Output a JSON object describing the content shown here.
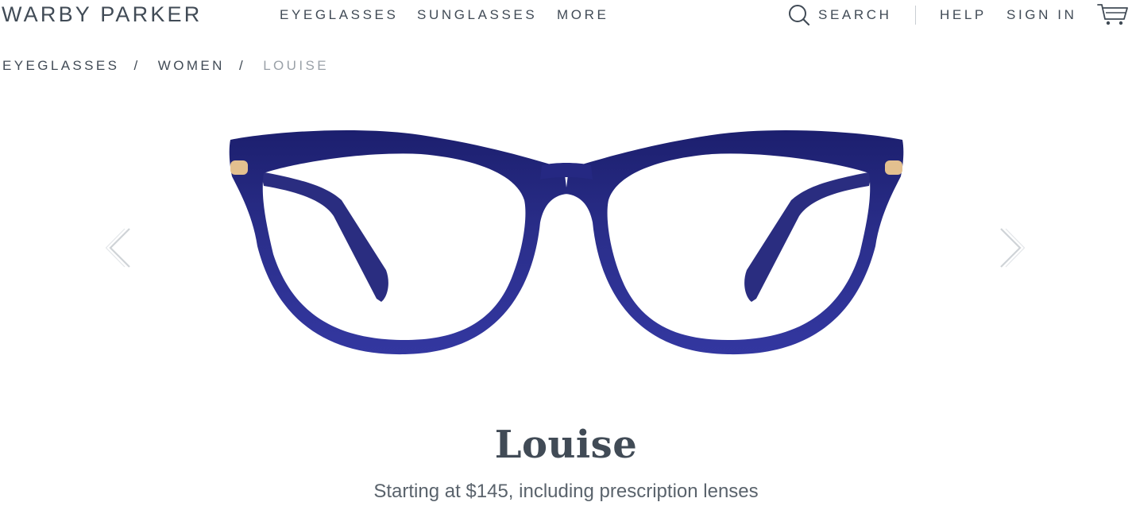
{
  "header": {
    "logo": "WARBY PARKER",
    "nav": {
      "eyeglasses": "EYEGLASSES",
      "sunglasses": "SUNGLASSES",
      "more": "MORE"
    },
    "search_label": "SEARCH",
    "help_label": "HELP",
    "signin_label": "SIGN IN",
    "icons": {
      "search": "search-icon",
      "cart": "cart-icon"
    }
  },
  "breadcrumb": {
    "items": [
      "EYEGLASSES",
      "WOMEN",
      "LOUISE"
    ],
    "separator": "/"
  },
  "gallery": {
    "frame_color": "#2b2f8c",
    "hinge_color": "#e3c08f",
    "icons": {
      "previous": "chevron-left-icon",
      "next": "chevron-right-icon"
    }
  },
  "product": {
    "name": "Louise",
    "price_text": "Starting at $145, including prescription lenses"
  }
}
